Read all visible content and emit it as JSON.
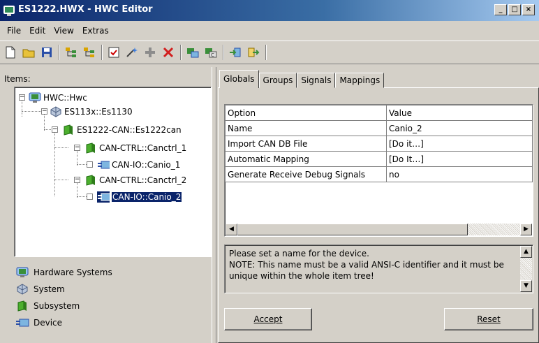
{
  "window": {
    "title": "ES1222.HWX - HWC Editor",
    "controls": [
      "_",
      "□",
      "×"
    ]
  },
  "menu": [
    "File",
    "Edit",
    "View",
    "Extras"
  ],
  "left": {
    "items_label": "Items:",
    "tree": [
      {
        "label": "HWC::Hwc",
        "icon": "hardware-system-icon"
      },
      {
        "label": "ES113x::Es1130",
        "icon": "system-icon"
      },
      {
        "label": "ES1222-CAN::Es1222can",
        "icon": "subsystem-icon"
      },
      {
        "label": "CAN-CTRL::Canctrl_1",
        "icon": "subsystem-icon"
      },
      {
        "label": "CAN-IO::Canio_1",
        "icon": "device-icon"
      },
      {
        "label": "CAN-CTRL::Canctrl_2",
        "icon": "subsystem-icon"
      },
      {
        "label": "CAN-IO::Canio_2",
        "icon": "device-icon",
        "selected": true
      }
    ],
    "legend": [
      {
        "label": "Hardware Systems",
        "icon": "hardware-system-icon"
      },
      {
        "label": "System",
        "icon": "system-icon"
      },
      {
        "label": "Subsystem",
        "icon": "subsystem-icon"
      },
      {
        "label": "Device",
        "icon": "device-icon"
      }
    ]
  },
  "tabs": [
    "Globals",
    "Groups",
    "Signals",
    "Mappings"
  ],
  "active_tab": "Globals",
  "grid": {
    "headers": [
      "Option",
      "Value"
    ],
    "rows": [
      [
        "Name",
        "Canio_2"
      ],
      [
        "Import CAN DB File",
        "[Do it…]"
      ],
      [
        "Automatic Mapping",
        "[Do It…]"
      ],
      [
        "Generate Receive Debug Signals",
        "no"
      ]
    ]
  },
  "description": {
    "line1": "Please set a name for the device.",
    "line2": "NOTE: This name must be a valid ANSI-C identifier and it must be unique within the whole item tree!"
  },
  "buttons": {
    "accept": "Accept",
    "reset": "Reset"
  },
  "colors": {
    "title_bar": "#0a246a",
    "selection": "#0a246a",
    "face": "#d4d0c8"
  }
}
